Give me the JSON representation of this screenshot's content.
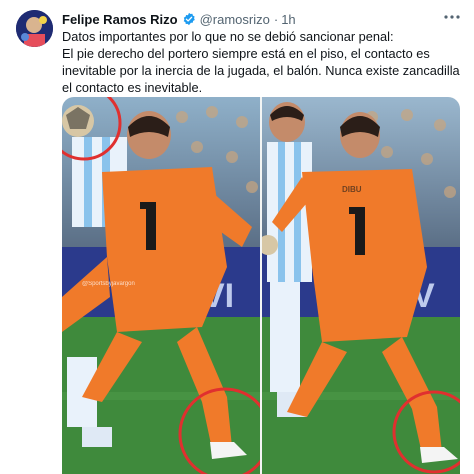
{
  "author": {
    "name": "Felipe Ramos Rizo",
    "handle": "@ramosrizo",
    "separator": "·",
    "time": "1h"
  },
  "tweet": {
    "lines": [
      "Datos importantes por lo que no se debió sancionar penal:",
      "El pie derecho del portero siempre está en el piso, el contacto es inevitable por la inercia de la jugada, el balón. Nunca existe zancadilla el contacto es inevitable."
    ]
  },
  "media": {
    "jersey_number": "1",
    "watermark": "@Sportsbyjavargon",
    "ad_board_text": "VI"
  },
  "colors": {
    "verified": "#1d9bf0",
    "goalkeeper_kit": "#f07a2a",
    "pitch": "#3f8a3c",
    "circle": "#e0302f"
  }
}
